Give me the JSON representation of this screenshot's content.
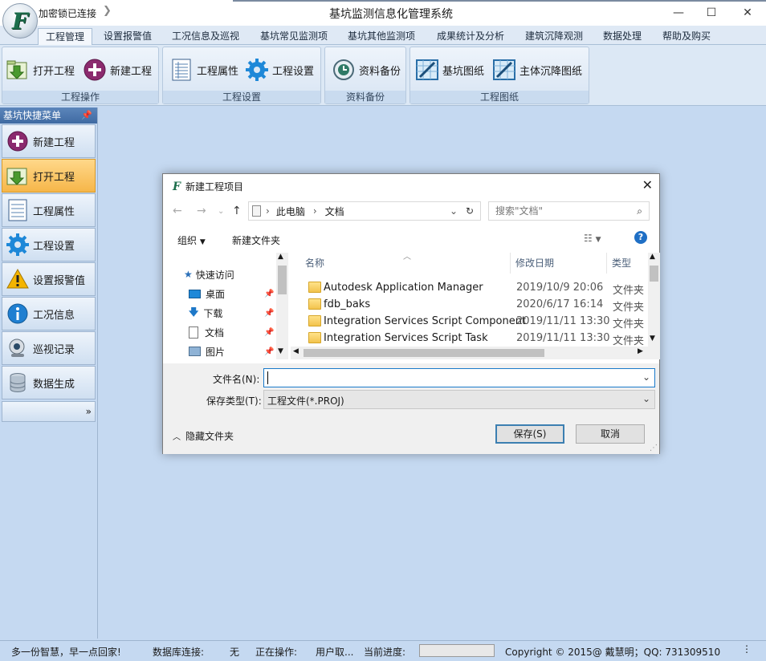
{
  "app": {
    "connection_status": "加密锁已连接",
    "title": "基坑监测信息化管理系统",
    "logo_letter": "F"
  },
  "tabs": [
    "工程管理",
    "设置报警值",
    "工况信息及巡视",
    "基坑常见监测项",
    "基坑其他监测项",
    "成果统计及分析",
    "建筑沉降观测",
    "数据处理",
    "帮助及购买"
  ],
  "ribbon": {
    "groups": [
      {
        "label": "工程操作",
        "buttons": [
          "打开工程",
          "新建工程"
        ]
      },
      {
        "label": "工程设置",
        "buttons": [
          "工程属性",
          "工程设置"
        ]
      },
      {
        "label": "资料备份",
        "buttons": [
          "资料备份"
        ]
      },
      {
        "label": "工程图纸",
        "buttons": [
          "基坑图纸",
          "主体沉降图纸"
        ]
      }
    ]
  },
  "sidebar": {
    "header": "基坑快捷菜单",
    "items": [
      {
        "label": "新建工程",
        "icon": "plus-icon"
      },
      {
        "label": "打开工程",
        "icon": "open-project-icon"
      },
      {
        "label": "工程属性",
        "icon": "properties-icon"
      },
      {
        "label": "工程设置",
        "icon": "gear-icon"
      },
      {
        "label": "设置报警值",
        "icon": "warning-icon"
      },
      {
        "label": "工况信息",
        "icon": "info-icon"
      },
      {
        "label": "巡视记录",
        "icon": "webcam-icon"
      },
      {
        "label": "数据生成",
        "icon": "database-icon"
      }
    ],
    "more": "»"
  },
  "dialog": {
    "title": "新建工程项目",
    "path": [
      "此电脑",
      "文档"
    ],
    "search_placeholder": "搜索\"文档\"",
    "toolbar": {
      "organize": "组织",
      "new_folder": "新建文件夹"
    },
    "nav_items": [
      {
        "label": "快速访问",
        "icon": "star-icon"
      },
      {
        "label": "桌面",
        "icon": "desktop-icon"
      },
      {
        "label": "下载",
        "icon": "download-icon"
      },
      {
        "label": "文档",
        "icon": "document-icon"
      },
      {
        "label": "图片",
        "icon": "pictures-icon"
      }
    ],
    "columns": {
      "name": "名称",
      "date": "修改日期",
      "type": "类型"
    },
    "files": [
      {
        "name": "Autodesk Application Manager",
        "date": "2019/10/9 20:06",
        "type": "文件夹"
      },
      {
        "name": "fdb_baks",
        "date": "2020/6/17 16:14",
        "type": "文件夹"
      },
      {
        "name": "Integration Services Script Component",
        "date": "2019/11/11 13:30",
        "type": "文件夹"
      },
      {
        "name": "Integration Services Script Task",
        "date": "2019/11/11 13:30",
        "type": "文件夹"
      }
    ],
    "filename_label": "文件名(N):",
    "filename_value": "",
    "filetype_label": "保存类型(T):",
    "filetype_value": "工程文件(*.PROJ)",
    "hide_folders": "隐藏文件夹",
    "save": "保存(S)",
    "cancel": "取消"
  },
  "statusbar": {
    "slogan": "多一份智慧，早一点回家!",
    "db_label": "数据库连接:",
    "db_value": "无",
    "op_label": "正在操作:",
    "op_value": "用户取...",
    "progress_label": "当前进度:",
    "progress_value": 0,
    "copyright": "Copyright © 2015@ 戴慧明；QQ: 731309510"
  }
}
